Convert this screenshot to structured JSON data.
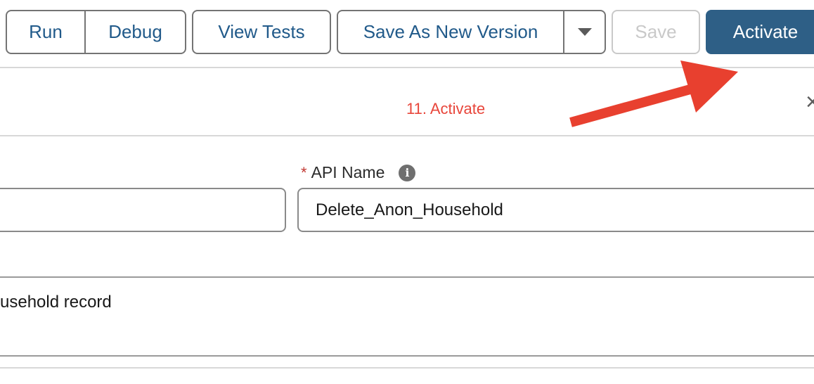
{
  "toolbar": {
    "run_label": "Run",
    "debug_label": "Debug",
    "view_tests_label": "View Tests",
    "save_as_new_version_label": "Save As New Version",
    "save_label": "Save",
    "activate_label": "Activate"
  },
  "popover": {
    "title": "11. Activate",
    "close_glyph": "×"
  },
  "form": {
    "api_name_required": "*",
    "api_name_label": "API Name",
    "info_glyph": "i",
    "label_value": "",
    "api_name_value": "Delete_Anon_Household",
    "description_value": "usehold record"
  },
  "colors": {
    "brand": "#2e5f86",
    "annotation": "#e8463b",
    "link_text": "#215a8a"
  }
}
